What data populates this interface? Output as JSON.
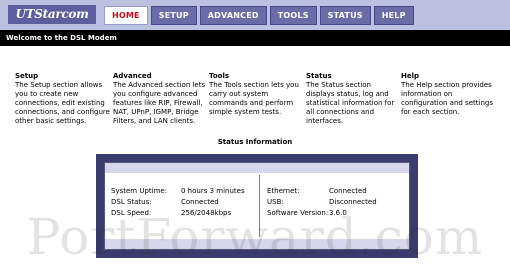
{
  "brand": {
    "logo_text": "UTStarcom"
  },
  "nav": {
    "tabs": [
      {
        "label": "HOME",
        "active": true
      },
      {
        "label": "SETUP",
        "active": false
      },
      {
        "label": "ADVANCED",
        "active": false
      },
      {
        "label": "TOOLS",
        "active": false
      },
      {
        "label": "STATUS",
        "active": false
      },
      {
        "label": "HELP",
        "active": false
      }
    ]
  },
  "welcome": {
    "text": "Welcome to the DSL Modem"
  },
  "sections": [
    {
      "title": "Setup",
      "desc": "The Setup section allows you to create new connections, edit existing connections, and configure other basic settings."
    },
    {
      "title": "Advanced",
      "desc": "The Advanced section lets you configure advanced features like RIP, Firewall, NAT, UPnP, IGMP, Bridge Filters, and LAN clients."
    },
    {
      "title": "Tools",
      "desc": "The Tools section lets you carry out system commands and perform simple system tests."
    },
    {
      "title": "Status",
      "desc": "The Status section displays status, log and statistical information for all connections and interfaces."
    },
    {
      "title": "Help",
      "desc": "The Help section provides information on configuration and settings for each section."
    }
  ],
  "status_info": {
    "title": "Status Information",
    "left": [
      {
        "label": "System Uptime:",
        "value": "0 hours 3 minutes"
      },
      {
        "label": "DSL Status:",
        "value": "Connected"
      },
      {
        "label": "DSL Speed:",
        "value": "256/2048kbps"
      }
    ],
    "right": [
      {
        "label": "Ethernet:",
        "value": "Connected"
      },
      {
        "label": "USB:",
        "value": "Disconnected"
      },
      {
        "label": "Software Version:",
        "value": "3.6.0"
      }
    ]
  },
  "watermark": {
    "text": "PortForward.com"
  },
  "colors": {
    "accent": "#6a6ca8",
    "active_tab_text": "#c0101a",
    "status_frame": "#3a3c6e"
  }
}
